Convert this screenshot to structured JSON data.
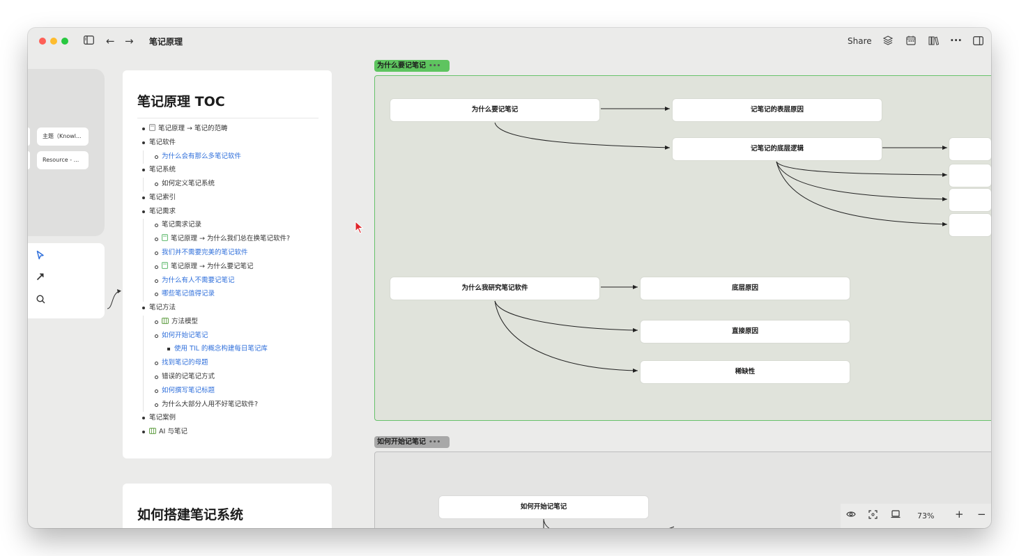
{
  "window": {
    "title": "笔记原理"
  },
  "toolbar": {
    "share_label": "Share",
    "back_icon": "←",
    "forward_icon": "→"
  },
  "left_panel": {
    "chips": [
      "主题（Knowl...",
      "Resource - ..."
    ]
  },
  "toc": {
    "title": "笔记原理 TOC",
    "items": [
      {
        "text": "笔记原理 → 笔记的范畴",
        "level": 0,
        "link": false,
        "icon": "page-icon"
      },
      {
        "text": "笔记软件",
        "level": 0,
        "link": false
      },
      {
        "text": "为什么会有那么多笔记软件",
        "level": 1,
        "link": true
      },
      {
        "text": "笔记系统",
        "level": 0,
        "link": false
      },
      {
        "text": "如何定义笔记系统",
        "level": 1,
        "link": false
      },
      {
        "text": "笔记索引",
        "level": 0,
        "link": false
      },
      {
        "text": "笔记需求",
        "level": 0,
        "link": false
      },
      {
        "text": "笔记需求记录",
        "level": 1,
        "link": false
      },
      {
        "text": "笔记原理 → 为什么我们总在换笔记软件?",
        "level": 1,
        "link": false,
        "icon": "page-icon"
      },
      {
        "text": "我们并不需要完美的笔记软件",
        "level": 1,
        "link": true
      },
      {
        "text": "笔记原理 → 为什么要记笔记",
        "level": 1,
        "link": false,
        "icon": "page-icon"
      },
      {
        "text": "为什么有人不需要记笔记",
        "level": 1,
        "link": true
      },
      {
        "text": "哪些笔记值得记录",
        "level": 1,
        "link": true
      },
      {
        "text": "笔记方法",
        "level": 0,
        "link": false
      },
      {
        "text": "方法模型",
        "level": 1,
        "link": false,
        "icon": "board-icon"
      },
      {
        "text": "如何开始记笔记",
        "level": 1,
        "link": true
      },
      {
        "text": "使用 TIL 的概念构建每日笔记库",
        "level": 2,
        "link": true
      },
      {
        "text": "找到笔记的母题",
        "level": 1,
        "link": true
      },
      {
        "text": "错误的记笔记方式",
        "level": 1,
        "link": false
      },
      {
        "text": "如何撰写笔记标题",
        "level": 1,
        "link": true
      },
      {
        "text": "为什么大部分人用不好笔记软件?",
        "level": 1,
        "link": false
      },
      {
        "text": "笔记案例",
        "level": 0,
        "link": false
      },
      {
        "text": "AI 与笔记",
        "level": 0,
        "link": false,
        "icon": "board-icon"
      }
    ]
  },
  "card2": {
    "title": "如何搭建笔记系统"
  },
  "groups": [
    {
      "label": "为什么要记笔记",
      "dots": "•••",
      "nodes": [
        "为什么要记笔记",
        "记笔记的表层原因",
        "记笔记的底层逻辑",
        "为什么我研究笔记软件",
        "底层原因",
        "直接原因",
        "稀缺性"
      ]
    },
    {
      "label": "如何开始记笔记",
      "dots": "•••",
      "nodes": [
        "如何开始记笔记"
      ]
    }
  ],
  "zoom": {
    "level": "73%",
    "plus": "+",
    "minus": "−"
  },
  "colors": {
    "link": "#2f6fdb",
    "group1_border": "#67c26b",
    "group1_bg": "#e0e3db",
    "group1_label_bg": "#5ec45f",
    "group2_label_bg": "#a8a8a8",
    "page_icon_green": "#5bb86a"
  }
}
